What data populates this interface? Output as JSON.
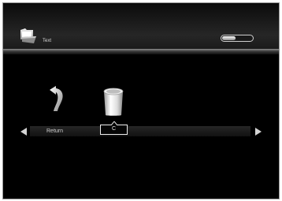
{
  "header": {
    "title": "Text",
    "folder_icon": "folder-icon",
    "battery_icon": "battery-icon",
    "battery_level": 0.45
  },
  "menu": {
    "items": [
      {
        "label": "Return",
        "icon": "return-arrow-icon"
      },
      {
        "label": "C",
        "icon": "trash-bin-icon"
      }
    ],
    "selected_index": 1,
    "left_arrow_icon": "chevron-left-icon",
    "right_arrow_icon": "chevron-right-icon"
  },
  "colors": {
    "background": "#000000",
    "text": "#d8d8d8",
    "highlight_border": "#ededed"
  }
}
